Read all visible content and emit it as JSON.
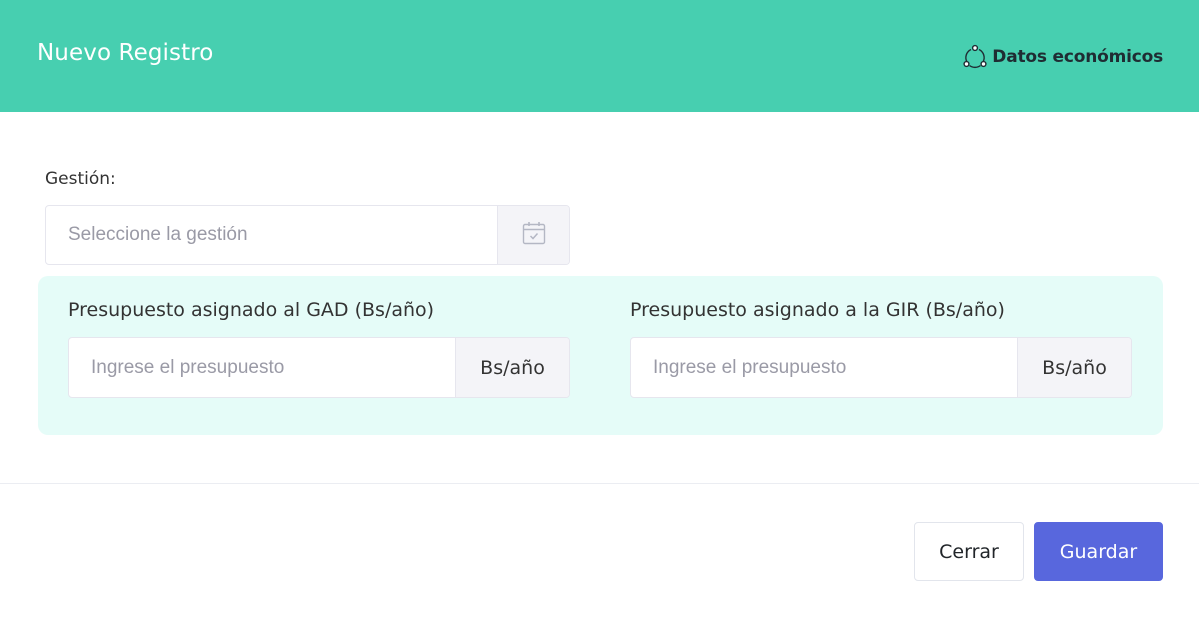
{
  "modal": {
    "title": "Nuevo Registro",
    "section_label": "Datos económicos",
    "section_icon": "circle-nodes-icon"
  },
  "gestion": {
    "label": "Gestión:",
    "placeholder": "Seleccione la gestión",
    "icon": "calendar-check-icon"
  },
  "budget": {
    "gad": {
      "label": "Presupuesto asignado al GAD (Bs/año)",
      "placeholder": "Ingrese el presupuesto",
      "unit": "Bs/año"
    },
    "gir": {
      "label": "Presupuesto asignado a la GIR (Bs/año)",
      "placeholder": "Ingrese el presupuesto",
      "unit": "Bs/año"
    }
  },
  "footer": {
    "close_label": "Cerrar",
    "save_label": "Guardar"
  },
  "colors": {
    "header_bg": "#47cfb0",
    "panel_bg": "#e5fcf8",
    "primary": "#5867dd"
  }
}
